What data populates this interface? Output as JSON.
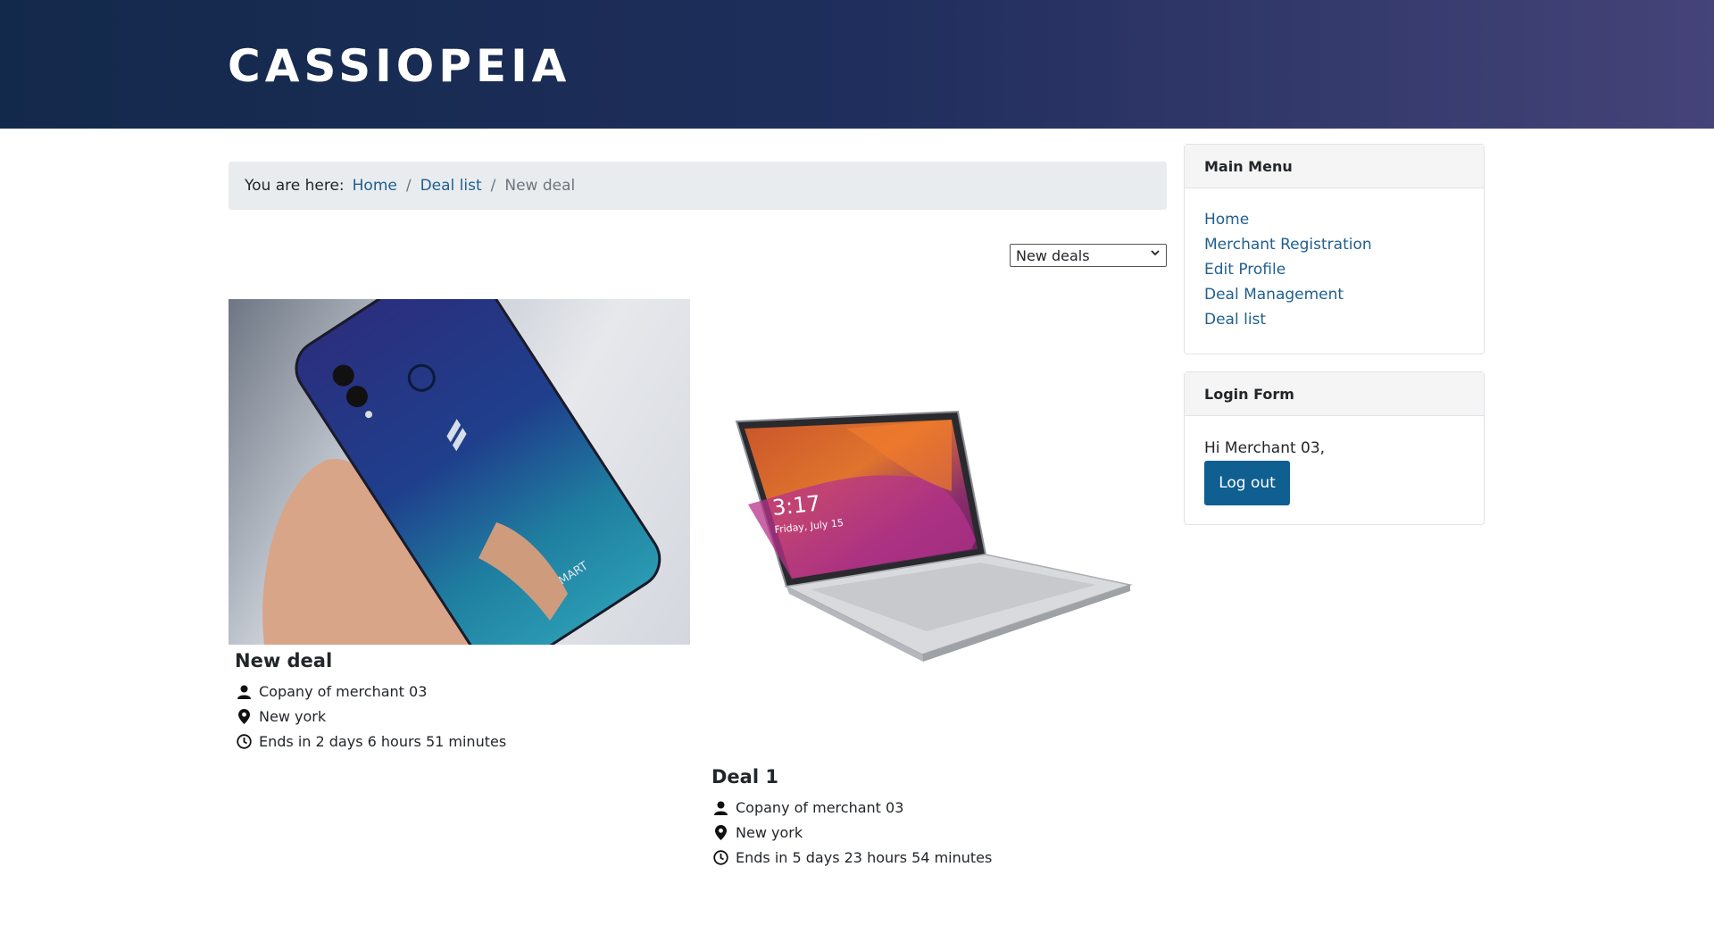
{
  "site": {
    "title": "CASSIOPEIA"
  },
  "breadcrumb": {
    "label": "You are here:",
    "items": [
      {
        "text": "Home"
      },
      {
        "text": "Deal list"
      }
    ],
    "current": "New deal",
    "separator": "/"
  },
  "sort": {
    "selected": "New deals"
  },
  "deals": [
    {
      "title": "New deal",
      "company": "Copany of merchant 03",
      "location": "New york",
      "ends": "Ends in 2 days 6 hours 51 minutes"
    },
    {
      "title": "Deal 1",
      "company": "Copany of merchant 03",
      "location": "New york",
      "ends": "Ends in 5 days 23 hours 54 minutes"
    }
  ],
  "main_menu": {
    "title": "Main Menu",
    "items": [
      {
        "label": "Home"
      },
      {
        "label": "Merchant Registration"
      },
      {
        "label": "Edit Profile"
      },
      {
        "label": "Deal Management"
      },
      {
        "label": "Deal list"
      }
    ]
  },
  "login_form": {
    "title": "Login Form",
    "greeting": "Hi Merchant 03,",
    "logout_label": "Log out"
  }
}
